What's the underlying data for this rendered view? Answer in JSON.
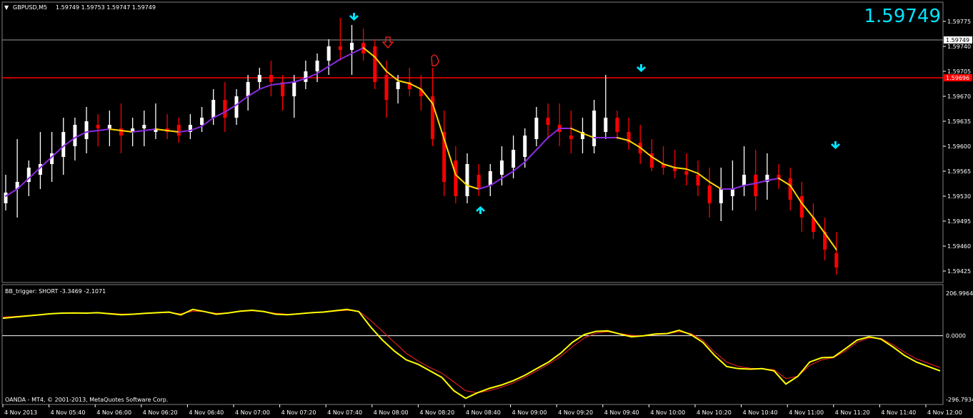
{
  "main_chart": {
    "symbol_label": "GBPUSD,M5",
    "ohlc_label": "1.59749 1.59753 1.59747 1.59749",
    "current_price": "1.59749",
    "price_axis": {
      "min": 1.5941,
      "max": 1.598,
      "ticks": [
        "1.59775",
        "1.59740",
        "1.59705",
        "1.59670",
        "1.59635",
        "1.59600",
        "1.59565",
        "1.59530",
        "1.59495",
        "1.59460",
        "1.59425"
      ],
      "current_box": "1.59749",
      "red_box": "1.59696"
    },
    "levels": {
      "grey_line": 1.59749,
      "red_line": 1.59696
    },
    "colors": {
      "bull": "#ffffff",
      "bear": "#ff0000",
      "ma_up": "#8a2be2",
      "ma_down": "#ffd800",
      "signal": "#00e5ff",
      "arrow_red": "#ff2020"
    }
  },
  "indicator": {
    "label": "BB_trigger: SHORT -3.3469 -2.1071",
    "ticks": [
      "206.9964",
      "0.0000",
      "-296.7934"
    ],
    "range": [
      -296.7934,
      206.9964
    ],
    "colors": {
      "fast": "#ffff00",
      "slow": "#ff2020",
      "zero": "#ffffff"
    }
  },
  "copyright": "OANDA - MT4, © 2001-2013, MetaQuotes Software Corp.",
  "time_axis": [
    "4 Nov 2013",
    "4 Nov 05:40",
    "4 Nov 06:00",
    "4 Nov 06:20",
    "4 Nov 06:40",
    "4 Nov 07:00",
    "4 Nov 07:20",
    "4 Nov 07:40",
    "4 Nov 08:00",
    "4 Nov 08:20",
    "4 Nov 08:40",
    "4 Nov 09:00",
    "4 Nov 09:20",
    "4 Nov 09:40",
    "4 Nov 10:00",
    "4 Nov 10:20",
    "4 Nov 10:40",
    "4 Nov 11:00",
    "4 Nov 11:20",
    "4 Nov 11:40",
    "4 Nov 12:00"
  ],
  "chart_data": {
    "type": "candlestick",
    "candles": [
      {
        "o": 1.5952,
        "h": 1.5956,
        "l": 1.5951,
        "c": 1.59535
      },
      {
        "o": 1.5954,
        "h": 1.5961,
        "l": 1.595,
        "c": 1.5955
      },
      {
        "o": 1.5955,
        "h": 1.5958,
        "l": 1.5953,
        "c": 1.5957
      },
      {
        "o": 1.5956,
        "h": 1.5962,
        "l": 1.5954,
        "c": 1.59575
      },
      {
        "o": 1.59575,
        "h": 1.5962,
        "l": 1.5955,
        "c": 1.5959
      },
      {
        "o": 1.59585,
        "h": 1.5964,
        "l": 1.5956,
        "c": 1.5962
      },
      {
        "o": 1.596,
        "h": 1.5964,
        "l": 1.5958,
        "c": 1.5963
      },
      {
        "o": 1.5961,
        "h": 1.59655,
        "l": 1.5959,
        "c": 1.59635
      },
      {
        "o": 1.5963,
        "h": 1.59645,
        "l": 1.596,
        "c": 1.59625
      },
      {
        "o": 1.59625,
        "h": 1.5965,
        "l": 1.596,
        "c": 1.5963
      },
      {
        "o": 1.59625,
        "h": 1.5966,
        "l": 1.5959,
        "c": 1.59615
      },
      {
        "o": 1.5962,
        "h": 1.5964,
        "l": 1.596,
        "c": 1.59625
      },
      {
        "o": 1.59625,
        "h": 1.5965,
        "l": 1.596,
        "c": 1.5963
      },
      {
        "o": 1.5962,
        "h": 1.5966,
        "l": 1.5961,
        "c": 1.59625
      },
      {
        "o": 1.59625,
        "h": 1.59645,
        "l": 1.5961,
        "c": 1.5962
      },
      {
        "o": 1.5963,
        "h": 1.5964,
        "l": 1.59605,
        "c": 1.59615
      },
      {
        "o": 1.5962,
        "h": 1.59645,
        "l": 1.5961,
        "c": 1.5963
      },
      {
        "o": 1.5963,
        "h": 1.59655,
        "l": 1.5962,
        "c": 1.5964
      },
      {
        "o": 1.5964,
        "h": 1.5968,
        "l": 1.5963,
        "c": 1.59665
      },
      {
        "o": 1.59665,
        "h": 1.5969,
        "l": 1.5962,
        "c": 1.5964
      },
      {
        "o": 1.5964,
        "h": 1.5968,
        "l": 1.5963,
        "c": 1.5967
      },
      {
        "o": 1.5967,
        "h": 1.597,
        "l": 1.5965,
        "c": 1.5969
      },
      {
        "o": 1.5969,
        "h": 1.5971,
        "l": 1.5968,
        "c": 1.597
      },
      {
        "o": 1.597,
        "h": 1.5972,
        "l": 1.5967,
        "c": 1.5969
      },
      {
        "o": 1.5969,
        "h": 1.597,
        "l": 1.5965,
        "c": 1.5967
      },
      {
        "o": 1.5967,
        "h": 1.597,
        "l": 1.5964,
        "c": 1.5969
      },
      {
        "o": 1.5969,
        "h": 1.5972,
        "l": 1.5968,
        "c": 1.59705
      },
      {
        "o": 1.59705,
        "h": 1.5973,
        "l": 1.5969,
        "c": 1.5972
      },
      {
        "o": 1.5972,
        "h": 1.5975,
        "l": 1.597,
        "c": 1.5974
      },
      {
        "o": 1.5974,
        "h": 1.5978,
        "l": 1.5972,
        "c": 1.59735
      },
      {
        "o": 1.59735,
        "h": 1.5977,
        "l": 1.597,
        "c": 1.59745
      },
      {
        "o": 1.59745,
        "h": 1.59765,
        "l": 1.5972,
        "c": 1.5973
      },
      {
        "o": 1.5974,
        "h": 1.5975,
        "l": 1.5968,
        "c": 1.5969
      },
      {
        "o": 1.597,
        "h": 1.5972,
        "l": 1.5964,
        "c": 1.59665
      },
      {
        "o": 1.5968,
        "h": 1.597,
        "l": 1.5966,
        "c": 1.5969
      },
      {
        "o": 1.5969,
        "h": 1.5971,
        "l": 1.5967,
        "c": 1.5968
      },
      {
        "o": 1.5968,
        "h": 1.597,
        "l": 1.5965,
        "c": 1.5967
      },
      {
        "o": 1.5967,
        "h": 1.5971,
        "l": 1.596,
        "c": 1.5961
      },
      {
        "o": 1.5962,
        "h": 1.5965,
        "l": 1.5953,
        "c": 1.5955
      },
      {
        "o": 1.5958,
        "h": 1.596,
        "l": 1.5952,
        "c": 1.5953
      },
      {
        "o": 1.5953,
        "h": 1.5959,
        "l": 1.5952,
        "c": 1.59575
      },
      {
        "o": 1.5956,
        "h": 1.59575,
        "l": 1.5953,
        "c": 1.5954
      },
      {
        "o": 1.59545,
        "h": 1.59575,
        "l": 1.5953,
        "c": 1.59565
      },
      {
        "o": 1.5956,
        "h": 1.596,
        "l": 1.59545,
        "c": 1.5958
      },
      {
        "o": 1.5957,
        "h": 1.59615,
        "l": 1.59555,
        "c": 1.59595
      },
      {
        "o": 1.59585,
        "h": 1.59625,
        "l": 1.5957,
        "c": 1.59615
      },
      {
        "o": 1.5961,
        "h": 1.59655,
        "l": 1.596,
        "c": 1.5964
      },
      {
        "o": 1.5964,
        "h": 1.5966,
        "l": 1.5961,
        "c": 1.5963
      },
      {
        "o": 1.5963,
        "h": 1.5966,
        "l": 1.596,
        "c": 1.5962
      },
      {
        "o": 1.59615,
        "h": 1.5965,
        "l": 1.5959,
        "c": 1.5961
      },
      {
        "o": 1.5961,
        "h": 1.5964,
        "l": 1.5959,
        "c": 1.5962
      },
      {
        "o": 1.596,
        "h": 1.59665,
        "l": 1.5959,
        "c": 1.5965
      },
      {
        "o": 1.5962,
        "h": 1.597,
        "l": 1.5961,
        "c": 1.5964
      },
      {
        "o": 1.5964,
        "h": 1.5965,
        "l": 1.5961,
        "c": 1.5962
      },
      {
        "o": 1.5962,
        "h": 1.5964,
        "l": 1.59595,
        "c": 1.59605
      },
      {
        "o": 1.59605,
        "h": 1.5963,
        "l": 1.59575,
        "c": 1.5959
      },
      {
        "o": 1.5959,
        "h": 1.5961,
        "l": 1.59565,
        "c": 1.5957
      },
      {
        "o": 1.59575,
        "h": 1.596,
        "l": 1.5956,
        "c": 1.5957
      },
      {
        "o": 1.5957,
        "h": 1.59595,
        "l": 1.59555,
        "c": 1.59565
      },
      {
        "o": 1.59565,
        "h": 1.5959,
        "l": 1.59545,
        "c": 1.5956
      },
      {
        "o": 1.5956,
        "h": 1.5958,
        "l": 1.5953,
        "c": 1.59545
      },
      {
        "o": 1.59545,
        "h": 1.5957,
        "l": 1.595,
        "c": 1.5952
      },
      {
        "o": 1.5952,
        "h": 1.5957,
        "l": 1.59495,
        "c": 1.5954
      },
      {
        "o": 1.5953,
        "h": 1.5958,
        "l": 1.5951,
        "c": 1.5954
      },
      {
        "o": 1.59545,
        "h": 1.596,
        "l": 1.5953,
        "c": 1.5956
      },
      {
        "o": 1.5956,
        "h": 1.59595,
        "l": 1.5951,
        "c": 1.5953
      },
      {
        "o": 1.5955,
        "h": 1.5959,
        "l": 1.59525,
        "c": 1.5956
      },
      {
        "o": 1.5956,
        "h": 1.59575,
        "l": 1.5954,
        "c": 1.59555
      },
      {
        "o": 1.59555,
        "h": 1.5957,
        "l": 1.5951,
        "c": 1.59525
      },
      {
        "o": 1.5953,
        "h": 1.5955,
        "l": 1.5948,
        "c": 1.595
      },
      {
        "o": 1.595,
        "h": 1.5952,
        "l": 1.5947,
        "c": 1.5948
      },
      {
        "o": 1.5948,
        "h": 1.595,
        "l": 1.5944,
        "c": 1.59455
      },
      {
        "o": 1.5945,
        "h": 1.5948,
        "l": 1.5942,
        "c": 1.5943
      }
    ],
    "ma": [
      1.5953,
      1.5954,
      1.59555,
      1.5957,
      1.59585,
      1.596,
      1.59612,
      1.5962,
      1.59622,
      1.59624,
      1.59622,
      1.5962,
      1.59622,
      1.59624,
      1.59622,
      1.5962,
      1.59622,
      1.59628,
      1.5964,
      1.59648,
      1.59658,
      1.5967,
      1.5968,
      1.59686,
      1.59688,
      1.5969,
      1.59695,
      1.59702,
      1.59712,
      1.59722,
      1.5973,
      1.59738,
      1.59725,
      1.59705,
      1.59692,
      1.59688,
      1.5968,
      1.5966,
      1.5961,
      1.5956,
      1.59545,
      1.5954,
      1.59545,
      1.59555,
      1.59565,
      1.59578,
      1.59595,
      1.59612,
      1.59625,
      1.59625,
      1.59618,
      1.59612,
      1.59612,
      1.59612,
      1.59608,
      1.59598,
      1.59585,
      1.59575,
      1.5957,
      1.59568,
      1.59562,
      1.5955,
      1.5954,
      1.5954,
      1.59545,
      1.59548,
      1.59552,
      1.59555,
      1.59545,
      1.5952,
      1.595,
      1.59478,
      1.59455
    ],
    "indicator_fast": [
      80,
      85,
      90,
      95,
      100,
      103,
      104,
      103,
      105,
      100,
      96,
      98,
      102,
      105,
      108,
      95,
      120,
      110,
      98,
      104,
      112,
      116,
      110,
      98,
      96,
      100,
      105,
      108,
      114,
      120,
      110,
      40,
      -20,
      -70,
      -110,
      -130,
      -160,
      -190,
      -250,
      -285,
      -260,
      -240,
      -225,
      -205,
      -180,
      -150,
      -120,
      -80,
      -30,
      5,
      20,
      22,
      8,
      -5,
      0,
      8,
      10,
      25,
      5,
      -30,
      -90,
      -140,
      -150,
      -152,
      -150,
      -160,
      -220,
      -185,
      -120,
      -100,
      -98,
      -60,
      -20,
      -5,
      -15,
      -50,
      -90,
      -120,
      -140,
      -160
    ],
    "indicator_slow": [
      85,
      88,
      92,
      96,
      100,
      102,
      103,
      104,
      104,
      102,
      99,
      99,
      101,
      104,
      106,
      100,
      112,
      110,
      102,
      104,
      110,
      114,
      110,
      102,
      98,
      100,
      104,
      107,
      112,
      116,
      112,
      70,
      20,
      -30,
      -80,
      -115,
      -145,
      -170,
      -210,
      -250,
      -260,
      -250,
      -235,
      -215,
      -190,
      -160,
      -130,
      -95,
      -50,
      -10,
      12,
      18,
      10,
      2,
      0,
      5,
      9,
      18,
      10,
      -20,
      -75,
      -120,
      -140,
      -148,
      -150,
      -155,
      -195,
      -185,
      -135,
      -110,
      -100,
      -70,
      -30,
      -10,
      -12,
      -40,
      -75,
      -105,
      -125,
      -145
    ]
  }
}
